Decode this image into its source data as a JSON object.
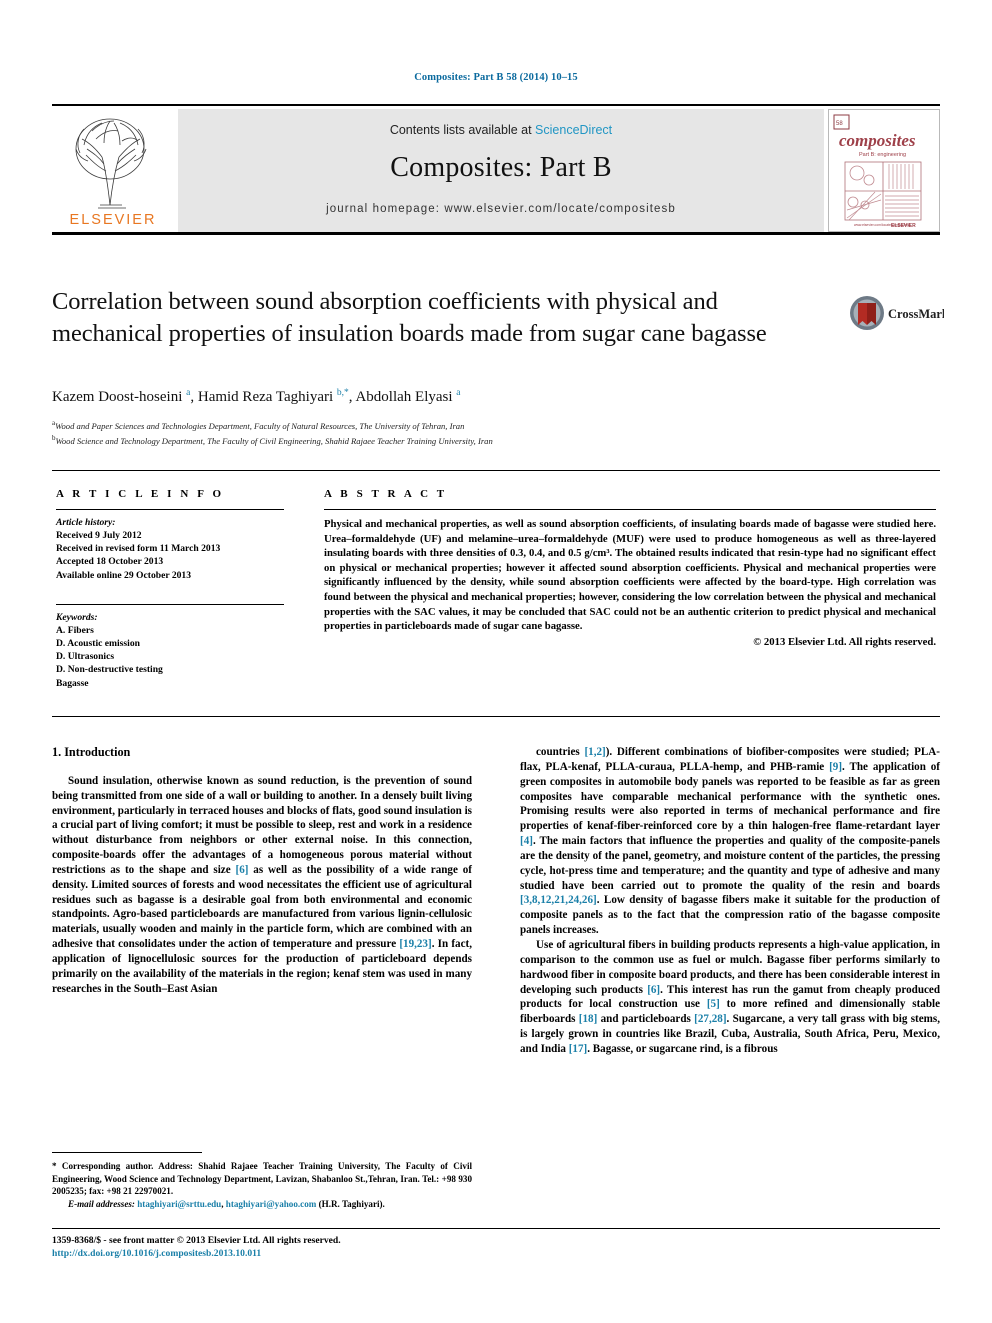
{
  "running_head": "Composites: Part B 58 (2014) 10–15",
  "masthead": {
    "contents_text": "Contents lists available at ",
    "sciencedirect": "ScienceDirect",
    "journal_title": "Composites: Part B",
    "homepage": "journal homepage: www.elsevier.com/locate/compositesb",
    "publisher_wordmark": "ELSEVIER",
    "cover_title": "composites",
    "cover_subtitle": "Part B: engineering"
  },
  "article": {
    "title": "Correlation between sound absorption coefficients with physical and mechanical properties of insulation boards made from sugar cane bagasse",
    "crossmark_label": "CrossMark",
    "authors_html": "Kazem Doost-hoseini <sup>a</sup>, Hamid Reza Taghiyari <sup>b,*</sup>, Abdollah Elyasi <sup>a</sup>",
    "affiliations": [
      {
        "marker": "a",
        "text": "Wood and Paper Sciences and Technologies Department, Faculty of Natural Resources, The University of Tehran, Iran"
      },
      {
        "marker": "b",
        "text": "Wood Science and Technology Department, The Faculty of Civil Engineering, Shahid Rajaee Teacher Training University, Iran"
      }
    ]
  },
  "info": {
    "heading": "A R T I C L E   I N F O",
    "history_label": "Article history:",
    "history": [
      "Received 9 July 2012",
      "Received in revised form 11 March 2013",
      "Accepted 18 October 2013",
      "Available online 29 October 2013"
    ],
    "keywords_label": "Keywords:",
    "keywords": [
      "A. Fibers",
      "D. Acoustic emission",
      "D. Ultrasonics",
      "D. Non-destructive testing",
      "Bagasse"
    ]
  },
  "abstract": {
    "heading": "A B S T R A C T",
    "text": "Physical and mechanical properties, as well as sound absorption coefficients, of insulating boards made of bagasse were studied here. Urea–formaldehyde (UF) and melamine–urea–formaldehyde (MUF) were used to produce homogeneous as well as three-layered insulating boards with three densities of 0.3, 0.4, and 0.5 g/cm³. The obtained results indicated that resin-type had no significant effect on physical or mechanical properties; however it affected sound absorption coefficients. Physical and mechanical properties were significantly influenced by the density, while sound absorption coefficients were affected by the board-type. High correlation was found between the physical and mechanical properties; however, considering the low correlation between the physical and mechanical properties with the SAC values, it may be concluded that SAC could not be an authentic criterion to predict physical and mechanical properties in particleboards made of sugar cane bagasse.",
    "rights": "© 2013 Elsevier Ltd. All rights reserved."
  },
  "body": {
    "section_heading": "1. Introduction",
    "left_p1_a": "Sound insulation, otherwise known as sound reduction, is the prevention of sound being transmitted from one side of a wall or building to another. In a densely built living environment, particularly in terraced houses and blocks of flats, good sound insulation is a crucial part of living comfort; it must be possible to sleep, rest and work in a residence without disturbance from neighbors or other external noise. In this connection, composite-boards offer the advantages of a homogeneous porous material without restrictions as to the shape and size ",
    "left_ref1": "[6]",
    "left_p1_b": " as well as the possibility of a wide range of density. Limited sources of forests and wood necessitates the efficient use of agricultural residues such as bagasse is a desirable goal from both environmental and economic standpoints. Agro-based particleboards are manufactured from various lignin-cellulosic materials, usually wooden and mainly in the particle form, which are combined with an adhesive that consolidates under the action of temperature and pressure ",
    "left_ref2": "[19,23]",
    "left_p1_c": ". In fact, application of lignocellulosic sources for the production of particleboard depends primarily on the availability of the materials in the region; kenaf stem was used in many researches in the South–East Asian",
    "right_p1_a": "countries ",
    "right_ref1": "[1,2]",
    "right_p1_b": "). Different combinations of biofiber-composites were studied; PLA-flax, PLA-kenaf, PLLA-curaua, PLLA-hemp, and PHB-ramie ",
    "right_ref2": "[9]",
    "right_p1_c": ". The application of green composites in automobile body panels was reported to be feasible as far as green composites have comparable mechanical performance with the synthetic ones. Promising results were also reported in terms of mechanical performance and fire properties of kenaf-fiber-reinforced core by a thin halogen-free flame-retardant layer ",
    "right_ref3": "[4]",
    "right_p1_d": ". The main factors that influence the properties and quality of the composite-panels are the density of the panel, geometry, and moisture content of the particles, the pressing cycle, hot-press time and temperature; and the quantity and type of adhesive and many studied have been carried out to promote the quality of the resin and boards ",
    "right_ref4": "[3,8,12,21,24,26]",
    "right_p1_e": ". Low density of bagasse fibers make it suitable for the production of composite panels as to the fact that the compression ratio of the bagasse composite panels increases.",
    "right_p2_a": "Use of agricultural fibers in building products represents a high-value application, in comparison to the common use as fuel or mulch. Bagasse fiber performs similarly to hardwood fiber in composite board products, and there has been considerable interest in developing such products ",
    "right_ref5": "[6]",
    "right_p2_b": ". This interest has run the gamut from cheaply produced products for local construction use ",
    "right_ref6": "[5]",
    "right_p2_c": " to more refined and dimensionally stable fiberboards ",
    "right_ref7": "[18]",
    "right_p2_d": " and particleboards ",
    "right_ref8": "[27,28]",
    "right_p2_e": ". Sugarcane, a very tall grass with big stems, is largely grown in countries like Brazil, Cuba, Australia, South Africa, Peru, Mexico, and India ",
    "right_ref9": "[17]",
    "right_p2_f": ". Bagasse, or sugarcane rind, is a fibrous"
  },
  "footnote": {
    "corresponding": "* Corresponding author. Address: Shahid Rajaee Teacher Training University, The Faculty of Civil Engineering, Wood Science and Technology Department, Lavizan, Shabanloo St.,Tehran, Iran. Tel.: +98 930 2005235; fax: +98 21 22970021.",
    "email_label": "E-mail addresses:",
    "email1": "htaghiyari@srttu.edu",
    "email_sep": ", ",
    "email2": "htaghiyari@yahoo.com",
    "email_owner": " (H.R. Taghiyari)."
  },
  "issn": {
    "line1": "1359-8368/$ - see front matter © 2013 Elsevier Ltd. All rights reserved.",
    "doi": "http://dx.doi.org/10.1016/j.compositesb.2013.10.011"
  },
  "colors": {
    "link": "#1a7fa8",
    "running_head": "#0b6a9e",
    "elsevier_orange": "#e87722",
    "sciencedirect": "#2196c4"
  }
}
